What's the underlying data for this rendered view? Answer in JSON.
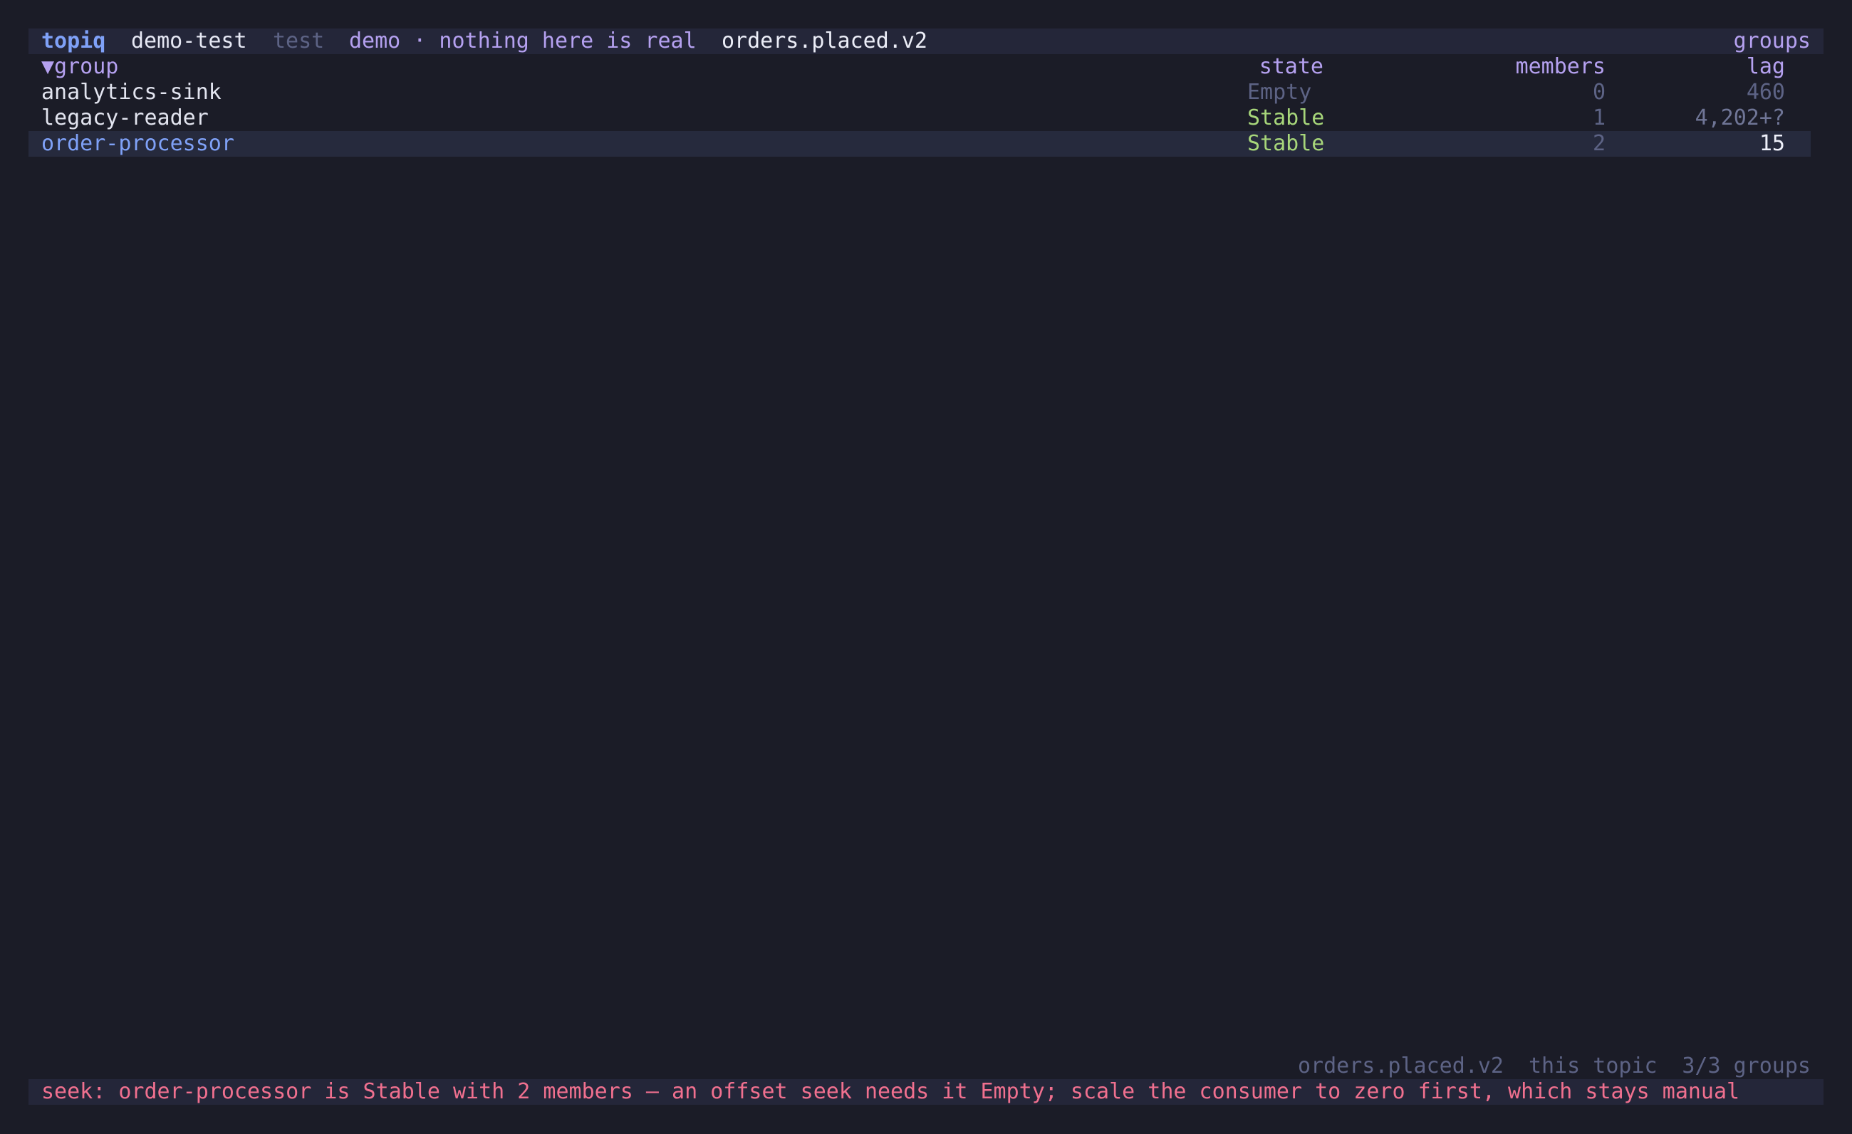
{
  "header": {
    "app_name": "topiq",
    "context": "demo-test",
    "environment": "test",
    "cluster": "demo · nothing here is real",
    "topic": "orders.placed.v2",
    "view": "groups"
  },
  "table": {
    "columns": {
      "group": "▼group",
      "state": "state",
      "members": "members",
      "lag": "lag"
    },
    "rows": [
      {
        "group": "analytics-sink",
        "state": "Empty",
        "members": "0",
        "lag": "460"
      },
      {
        "group": "legacy-reader",
        "state": "Stable",
        "members": "1",
        "lag": "4,202+?"
      },
      {
        "group": "order-processor",
        "state": "Stable",
        "members": "2",
        "lag": "15"
      }
    ],
    "selected_row": 2
  },
  "footer": {
    "topic": "orders.placed.v2",
    "scope": "this topic",
    "count": "3/3 groups"
  },
  "status": {
    "message": "seek: order-processor is Stable with 2 members — an offset seek needs it Empty; scale the consumer to zero first, which stays manual"
  },
  "colors": {
    "background": "#1b1c27",
    "bar": "#242639",
    "accent": "#7fa1f7",
    "header_text": "#b5a1f0",
    "stable": "#a7d67a",
    "error": "#f0708f"
  }
}
